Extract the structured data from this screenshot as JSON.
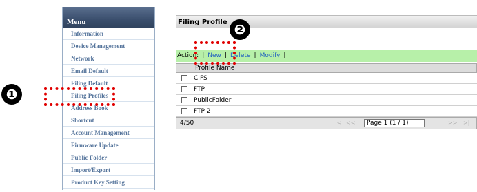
{
  "callouts": {
    "one": "❶",
    "two": "❷"
  },
  "sidebar": {
    "header": "Menu",
    "items": [
      "Information",
      "Device Management",
      "Network",
      "Email Default",
      "Filing Default",
      "Filing Profiles",
      "Address Book",
      "Shortcut",
      "Account Management",
      "Firmware Update",
      "Public Folder",
      "Import/Export",
      "Product Key Setting"
    ]
  },
  "main": {
    "title": "Filing Profile",
    "action_bar": {
      "label": "Action:",
      "new": "New",
      "delete": "Delete",
      "modify": "Modify"
    },
    "table": {
      "column": "Profile Name",
      "rows": [
        "CIFS",
        "FTP",
        "PublicFolder",
        "FTP 2"
      ]
    },
    "footer": {
      "count": "4/50",
      "first": "|<",
      "prev": "<<",
      "page": "Page 1 (1 / 1)",
      "next": ">>",
      "last": ">|"
    }
  },
  "colors": {
    "menu_header": "#3b4f6e",
    "menu_text": "#56759c",
    "action_bar": "#b7f0a9",
    "callout": "#e00000"
  }
}
